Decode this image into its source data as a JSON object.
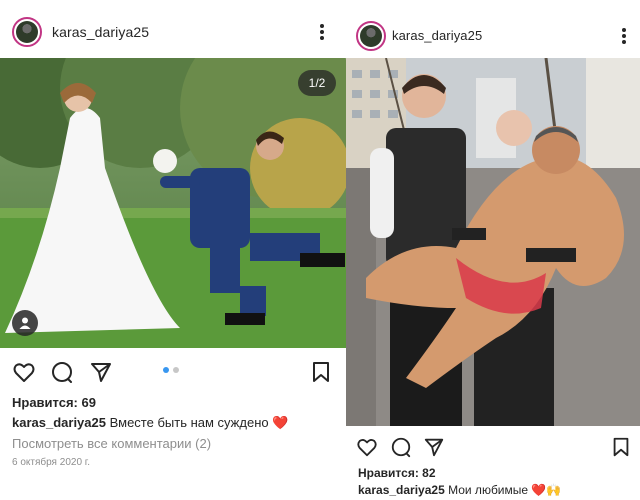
{
  "left_post": {
    "username": "karas_dariya25",
    "counter": "1/2",
    "likes": "Нравится: 69",
    "caption_user": "karas_dariya25",
    "caption_text": "Вместе быть нам суждено ❤️",
    "view_comments": "Посмотреть все комментарии (2)",
    "date": "6 октября 2020 г."
  },
  "right_post": {
    "username": "karas_dariya25",
    "likes": "Нравится: 82",
    "caption_user": "karas_dariya25",
    "caption_text": "Мои любимые ❤️🙌"
  },
  "colors": {
    "text": "#262626",
    "muted": "#8e8e8e",
    "accent_dot": "#3897f0",
    "heart_emoji": "#ed4956"
  },
  "icons": [
    "more-options-icon",
    "heart-icon",
    "comment-icon",
    "share-icon",
    "bookmark-icon",
    "user-tag-icon"
  ]
}
